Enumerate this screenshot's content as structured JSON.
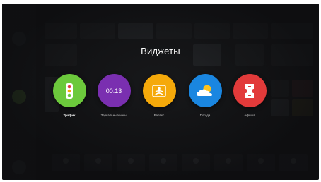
{
  "overlay": {
    "title": "Виджеты"
  },
  "widgets": [
    {
      "label": "Трафик",
      "icon": "traffic-light-icon",
      "color": "#6cc93c",
      "active": true
    },
    {
      "label": "Зеркальные часы",
      "icon": "clock-text",
      "value": "00:13",
      "color": "#7a2fb0",
      "active": false
    },
    {
      "label": "Релакс",
      "icon": "meditation-icon",
      "color": "#f5a90a",
      "active": false
    },
    {
      "label": "Погода",
      "icon": "weather-cloud-sun-icon",
      "color": "#1a86e0",
      "active": false
    },
    {
      "label": "Афиша",
      "icon": "ticket-icon",
      "color": "#e23a3a",
      "active": false
    }
  ],
  "colors": {
    "screen_bg": "#1a1b1d",
    "title": "#ffffff"
  }
}
